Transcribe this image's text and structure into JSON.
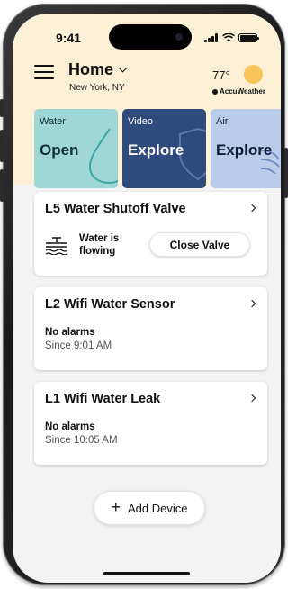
{
  "status_bar": {
    "time": "9:41"
  },
  "header": {
    "title": "Home",
    "location": "New York, NY",
    "temperature": "77°",
    "weather_provider": "AccuWeather"
  },
  "tiles": [
    {
      "label": "Water",
      "value": "Open",
      "color": "#9fd7d6"
    },
    {
      "label": "Video",
      "value": "Explore",
      "color": "#2f4a7d"
    },
    {
      "label": "Air",
      "value": "Explore",
      "color": "#b9cce9"
    }
  ],
  "devices": {
    "valve": {
      "title": "L5 Water Shutoff Valve",
      "status": "Water is flowing",
      "button": "Close Valve"
    },
    "sensor": {
      "title": "L2 Wifi Water Sensor",
      "status": "No alarms",
      "since": "Since 9:01 AM"
    },
    "leak": {
      "title": "L1 Wifi Water Leak",
      "status": "No alarms",
      "since": "Since 10:05 AM"
    }
  },
  "add_device": {
    "icon": "plus-icon",
    "label": "Add Device"
  }
}
